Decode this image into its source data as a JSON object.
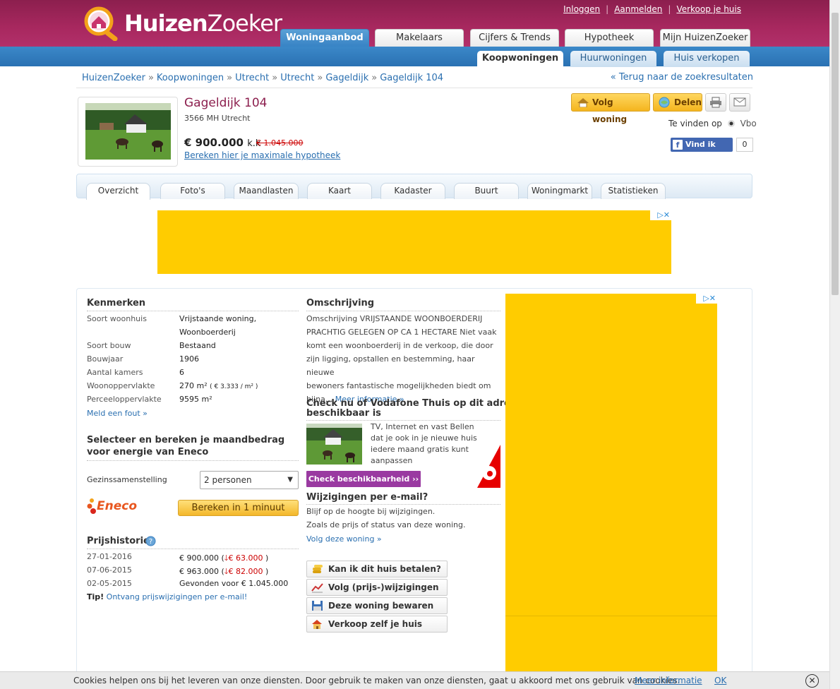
{
  "logo": {
    "text_bold": "Huizen",
    "text_light": "Zoeker"
  },
  "top_links": [
    "Inloggen",
    "Aanmelden",
    "Verkoop je huis"
  ],
  "main_tabs": [
    "Woningaanbod",
    "Makelaars",
    "Cijfers & Trends",
    "Hypotheek",
    "Mijn HuizenZoeker"
  ],
  "sub_tabs": [
    "Koopwoningen",
    "Huurwoningen",
    "Huis verkopen"
  ],
  "breadcrumb": [
    "HuizenZoeker",
    "Koopwoningen",
    "Utrecht",
    "Utrecht",
    "Gageldijk",
    "Gageldijk 104"
  ],
  "breadcrumb_sep": "»",
  "back_link": "« Terug naar de zoekresultaten",
  "listing": {
    "title": "Gageldijk 104",
    "city": "3566 MH Utrecht",
    "price": "€ 900.000",
    "price_suffix": "k.k",
    "price_old": "€ 1.045.000",
    "mortgage_link": "Bereken hier je maximale hypotheek"
  },
  "actions": {
    "follow": "Volg woning",
    "share": "Delen",
    "found_on": "Te vinden op",
    "source": "Vbo",
    "fb_like": "Vind ik leuk",
    "fb_count": "0"
  },
  "detail_tabs": [
    "Overzicht",
    "Foto's",
    "Maandlasten",
    "Kaart",
    "Kadaster",
    "Buurt",
    "Woningmarkt",
    "Statistieken"
  ],
  "kenmerken": {
    "title": "Kenmerken",
    "rows": [
      {
        "label": "Soort woonhuis",
        "value": "Vrijstaande woning,"
      },
      {
        "label": "",
        "value": "Woonboerderij"
      },
      {
        "label": "Soort bouw",
        "value": "Bestaand"
      },
      {
        "label": "Bouwjaar",
        "value": "1906"
      },
      {
        "label": "Aantal kamers",
        "value": "6"
      },
      {
        "label": "Woonoppervlakte",
        "value": "270 m²",
        "extra": "( € 3.333 / m² )"
      },
      {
        "label": "Perceeloppervlakte",
        "value": "9595 m²"
      }
    ],
    "report_link": "Meld een fout »"
  },
  "energy": {
    "title_line1": "Selecteer en bereken je maandbedrag",
    "title_line2": "voor energie van Eneco",
    "household_label": "Gezinssamenstelling",
    "household_value": "2 personen",
    "brand": "Eneco",
    "button": "Bereken in 1 minuut"
  },
  "price_history": {
    "title": "Prijshistorie",
    "rows": [
      {
        "date": "27-01-2016",
        "value": "€ 900.000 (",
        "change": "€ 63.000",
        "close": ")"
      },
      {
        "date": "07-06-2015",
        "value": "€ 963.000 (",
        "change": "€ 82.000",
        "close": ")"
      },
      {
        "date": "02-05-2015",
        "value": "Gevonden voor € 1.045.000",
        "change": "",
        "close": ""
      }
    ],
    "tip_label": "Tip!",
    "tip_link": "Ontvang prijswijzigingen per e-mail!"
  },
  "description": {
    "title": "Omschrijving",
    "lines": [
      "Omschrijving VRIJSTAANDE WOONBOERDERIJ",
      "PRACHTIG GELEGEN OP CA 1 HECTARE Niet vaak",
      "komt een woonboerderij in de verkoop, die door",
      "zijn ligging, opstallen en bestemming, haar nieuwe",
      "bewoners fantastische mogelijkheden biedt om",
      "bijna..."
    ],
    "more_link": "Meer informatie »"
  },
  "vodafone": {
    "title_line1": "Check nu of Vodafone Thuis op dit adres",
    "title_line2": "beschikbaar is",
    "lines": [
      "TV, Internet en vast Bellen",
      "dat je ook in je nieuwe huis",
      "iedere maand gratis kunt",
      "aanpassen"
    ],
    "button": "Check beschikbaarheid ››"
  },
  "email_changes": {
    "title": "Wijzigingen per e-mail?",
    "line1": "Blijf op de hoogte bij wijzigingen.",
    "line2": "Zoals de prijs of status van deze woning.",
    "link": "Volg deze woning »"
  },
  "action_buttons": [
    "Kan ik dit huis betalen?",
    "Volg (prijs-)wijzigingen",
    "Deze woning bewaren",
    "Verkoop zelf je huis"
  ],
  "cookie": {
    "text": "Cookies helpen ons bij het leveren van onze diensten. Door gebruik te maken van onze diensten, gaat u akkoord met ons gebruik van cookies.",
    "more": "Meer informatie",
    "ok": "OK",
    "close": "✕"
  },
  "colors": {
    "brand": "#a8285f",
    "nav_blue": "#2f78ba",
    "ad_yellow": "#ffcc00",
    "link": "#2a6fb0"
  }
}
